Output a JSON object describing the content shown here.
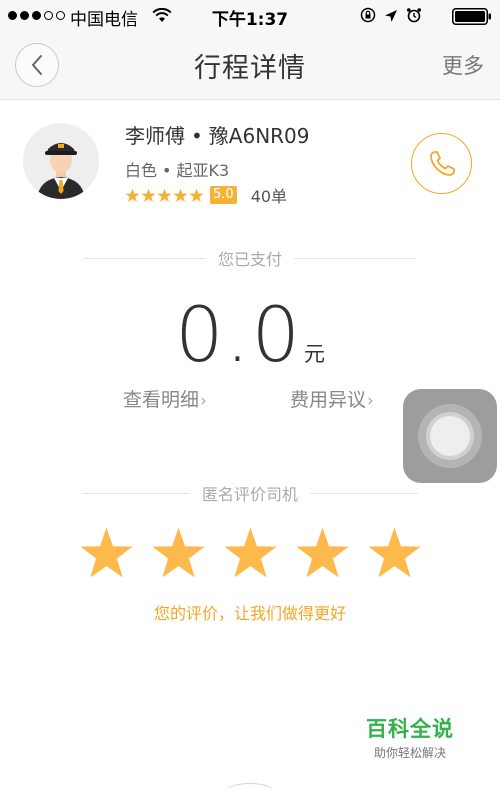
{
  "status_bar": {
    "carrier": "中国电信",
    "time": "下午1:37"
  },
  "nav": {
    "title": "行程详情",
    "more": "更多"
  },
  "driver": {
    "name": "李师傅",
    "separator": "•",
    "plate": "豫A6NR09",
    "car_color": "白色",
    "car_model": "起亚K3",
    "rating": "5.0",
    "rating_stars": 5,
    "orders": "40单"
  },
  "payment": {
    "label": "您已支付",
    "amount": "0.0",
    "unit": "元",
    "details_link": "查看明细",
    "dispute_link": "费用异议"
  },
  "review": {
    "label": "匿名评价司机",
    "stars_selected": 5,
    "hint": "您的评价，让我们做得更好"
  },
  "watermark": {
    "title": "百科全说",
    "subtitle": "助你轻松解决"
  },
  "colors": {
    "accent": "#f5a623",
    "star": "#fdb94b",
    "badge": "#f5b335"
  }
}
